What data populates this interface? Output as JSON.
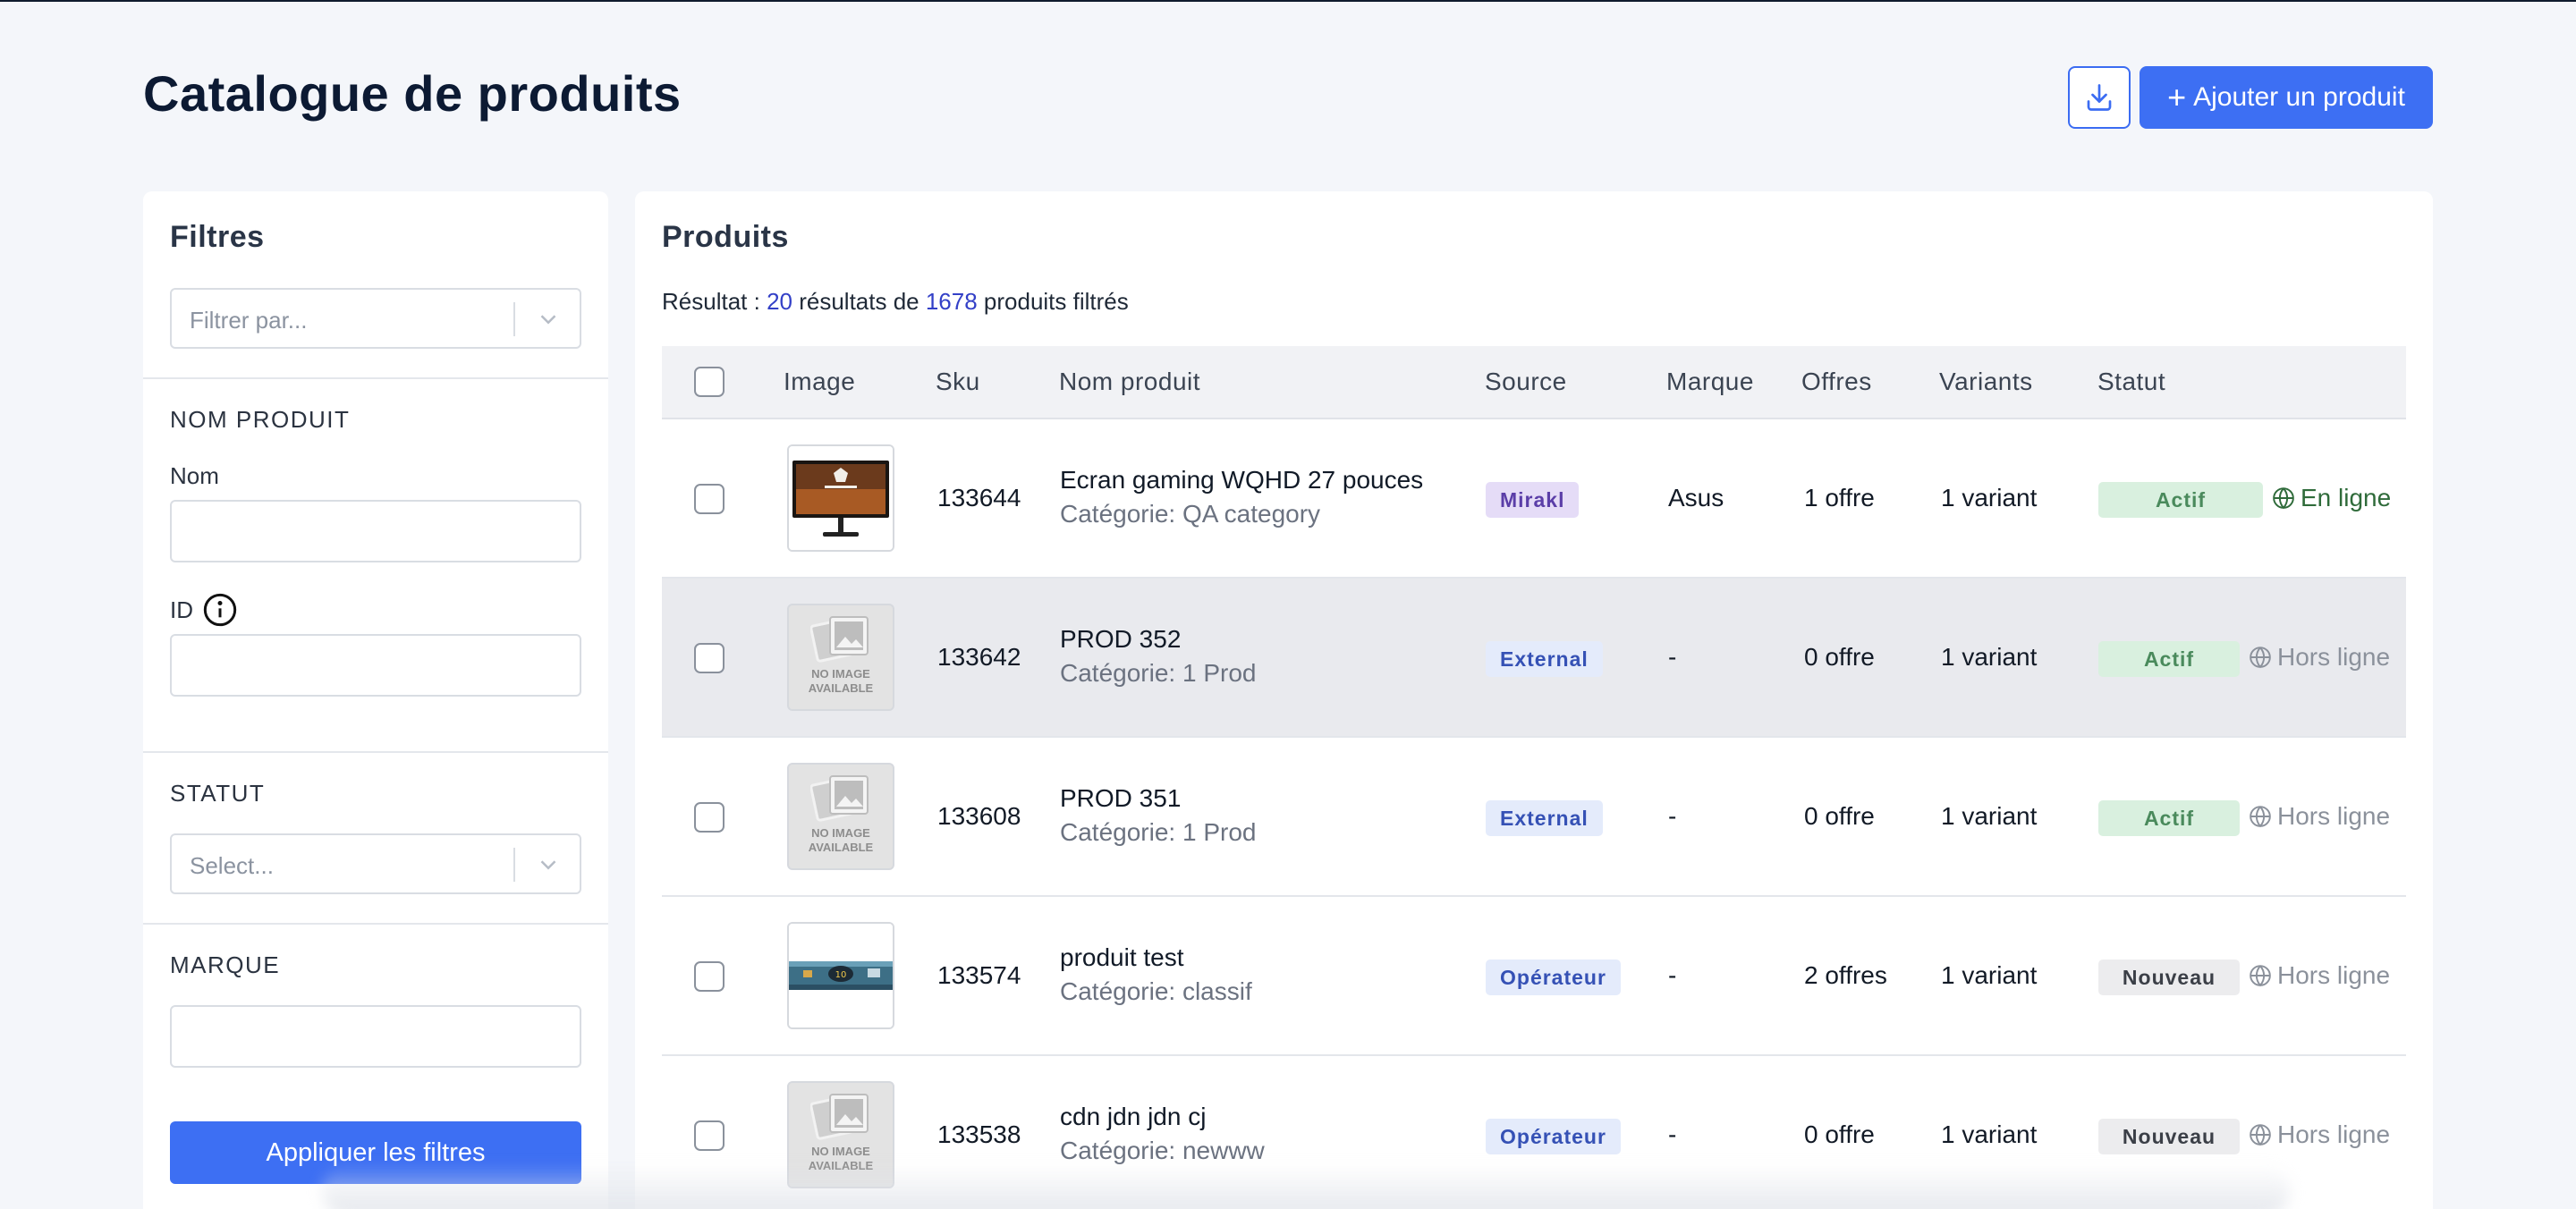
{
  "header": {
    "title": "Catalogue de produits",
    "add_label": "Ajouter un produit",
    "accent": "#3d6ff3"
  },
  "filters": {
    "title": "Filtres",
    "filter_by_placeholder": "Filtrer par...",
    "name_section": "NOM PRODUIT",
    "name_label": "Nom",
    "name_value": "",
    "id_label": "ID",
    "id_value": "",
    "status_section": "STATUT",
    "status_placeholder": "Select...",
    "brand_section": "MARQUE",
    "brand_value": "",
    "apply_label": "Appliquer les filtres"
  },
  "products": {
    "title": "Produits",
    "result_prefix": "Résultat : ",
    "result_count": "20",
    "result_mid": " résultats de ",
    "result_total": "1678",
    "result_suffix": " produits filtrés",
    "columns": [
      "Image",
      "Sku",
      "Nom produit",
      "Source",
      "Marque",
      "Offres",
      "Variants",
      "Statut"
    ],
    "rows": [
      {
        "sku": "133644",
        "name": "Ecran gaming WQHD 27 pouces",
        "category": "Catégorie: QA category",
        "source": "Mirakl",
        "brand": "Asus",
        "offers": "1 offre",
        "variants": "1 variant",
        "status": "Actif",
        "online": "En ligne",
        "image": "monitor"
      },
      {
        "sku": "133642",
        "name": "PROD 352",
        "category": "Catégorie: 1 Prod",
        "source": "External",
        "brand": "-",
        "offers": "0 offre",
        "variants": "1 variant",
        "status": "Actif",
        "online": "Hors ligne",
        "image": "none"
      },
      {
        "sku": "133608",
        "name": "PROD 351",
        "category": "Catégorie: 1 Prod",
        "source": "External",
        "brand": "-",
        "offers": "0 offre",
        "variants": "1 variant",
        "status": "Actif",
        "online": "Hors ligne",
        "image": "none"
      },
      {
        "sku": "133574",
        "name": "produit test",
        "category": "Catégorie: classif",
        "source": "Opérateur",
        "brand": "-",
        "offers": "2 offres",
        "variants": "1 variant",
        "status": "Nouveau",
        "online": "Hors ligne",
        "image": "banner"
      },
      {
        "sku": "133538",
        "name": "cdn jdn jdn cj",
        "category": "Catégorie: newww",
        "source": "Opérateur",
        "brand": "-",
        "offers": "0 offre",
        "variants": "1 variant",
        "status": "Nouveau",
        "online": "Hors ligne",
        "image": "none"
      }
    ],
    "no_image_text": "NO IMAGE AVAILABLE"
  }
}
